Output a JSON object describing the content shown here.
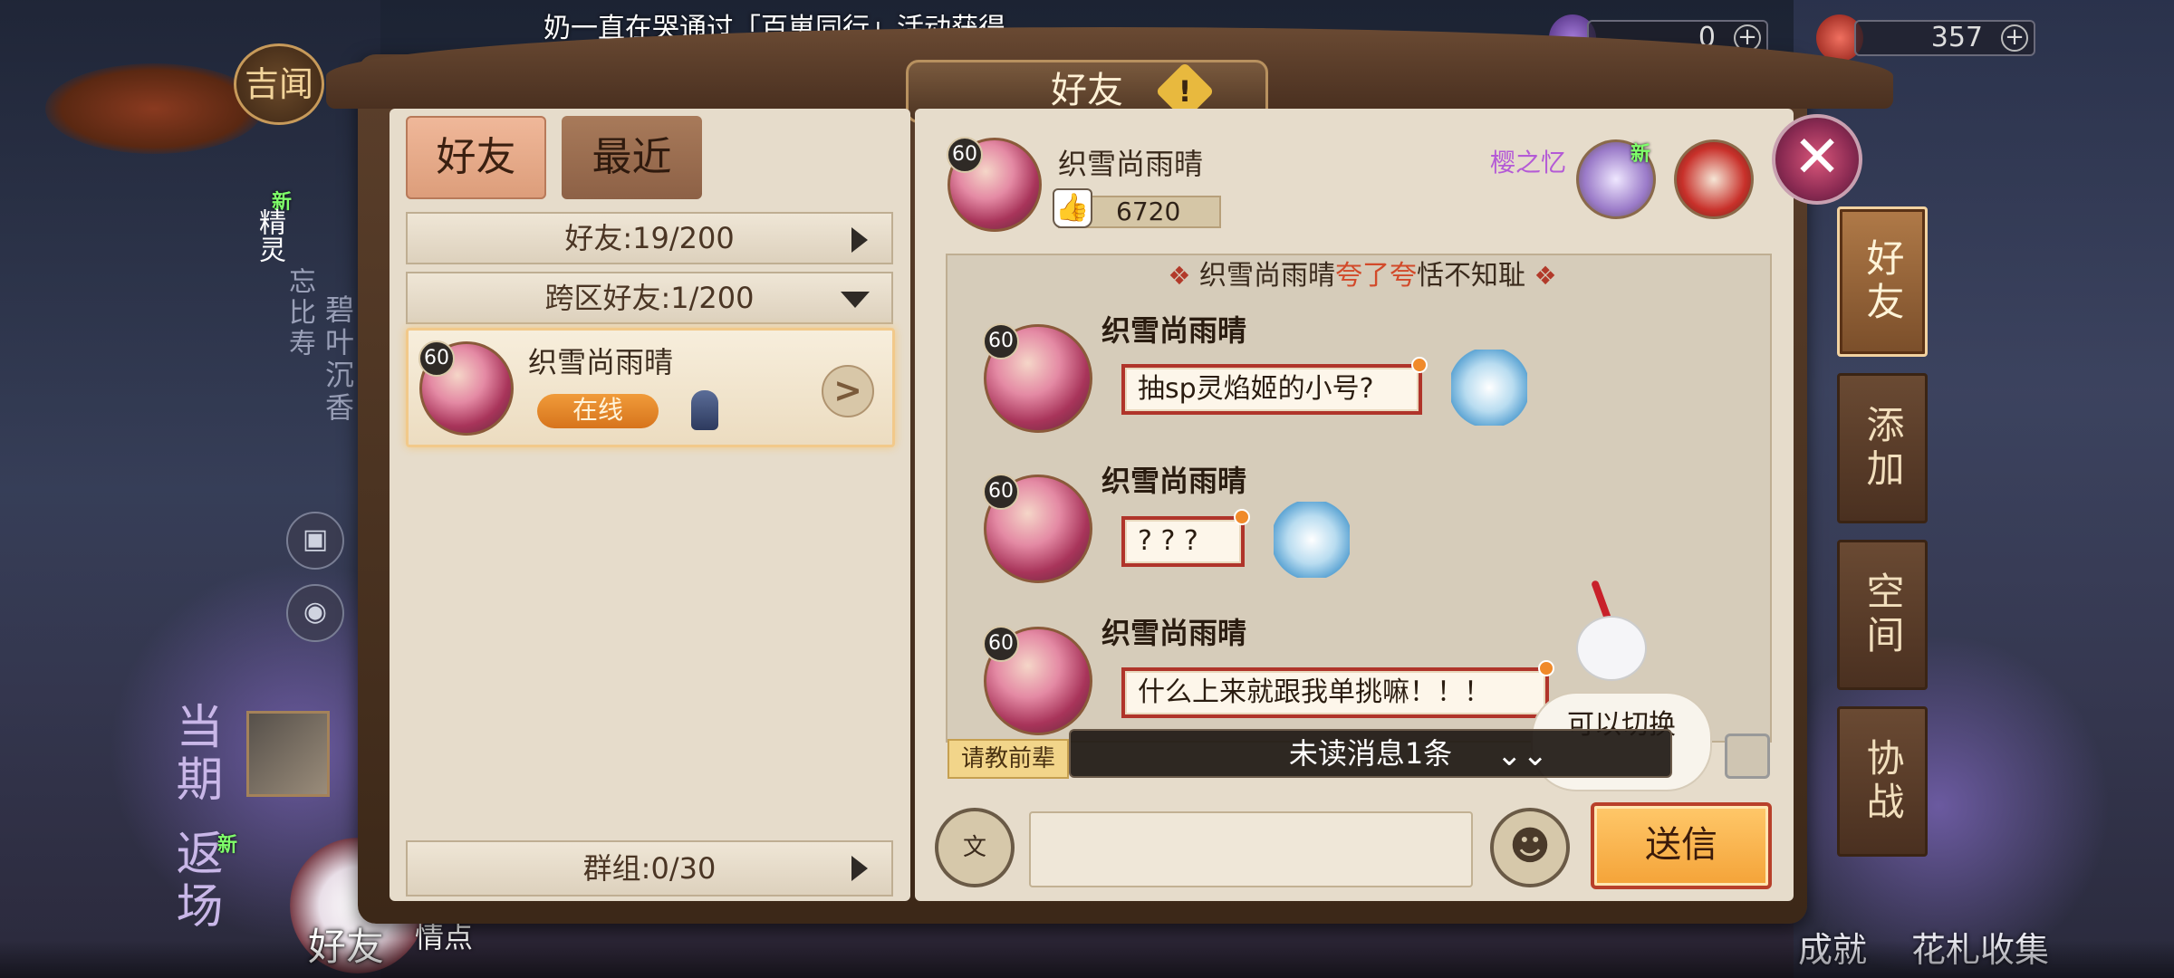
{
  "ticker": {
    "text": "奶一直在哭通过「百崽同行」活动获得"
  },
  "currencies": [
    {
      "value": "0",
      "plus": "+",
      "color": "#6a3aa0"
    },
    {
      "value": "357",
      "plus": "+",
      "color": "#c8302a"
    }
  ],
  "left_hud": {
    "jiwen_label": "吉闻",
    "sprite_label": "精灵",
    "sprite_new": "新",
    "side_text_1": "碧叶沉香",
    "side_text_2": "忘比寿",
    "current_label": "当期",
    "return_label": "返场",
    "return_new": "新",
    "friends_label": "好友",
    "qingdian_label": "情点"
  },
  "right_hud": {
    "achievement_label": "成就",
    "card_collect_label": "花札收集"
  },
  "panel": {
    "title": "好友",
    "warn_icon": "!",
    "close_icon": "✕"
  },
  "tabs": {
    "friends": "好友",
    "recent": "最近"
  },
  "friend_list": {
    "friends_count": "好友:19/200",
    "cross_server_count": "跨区好友:1/200",
    "group_count": "群组:0/30",
    "entries": [
      {
        "level": "60",
        "name": "织雪尚雨晴",
        "status": "在线"
      }
    ]
  },
  "chat": {
    "partner_level": "60",
    "partner_name": "织雪尚雨晴",
    "likes": "6720",
    "title_tag": "樱之忆",
    "title_new": "新",
    "praise": {
      "diamond": "❖",
      "name": "织雪尚雨晴",
      "action": "夸了夸",
      "trait": "恬不知耻"
    },
    "messages": [
      {
        "level": "60",
        "name": "织雪尚雨晴",
        "text": "抽sp灵焰姬的小号?"
      },
      {
        "level": "60",
        "name": "织雪尚雨晴",
        "text": "? ? ?"
      },
      {
        "level": "60",
        "name": "织雪尚雨晴",
        "text": "什么上来就跟我单挑嘛！！！"
      }
    ],
    "quick_tag": "请教前辈",
    "unread": "未读消息1条",
    "unread_icon": "⌄⌄",
    "mascot_tip": "可以切换",
    "input_value": "",
    "voice_label": "文",
    "emoji_icon": "☻",
    "send_label": "送信"
  },
  "side_tabs": [
    "好友",
    "添加",
    "空间",
    "协战"
  ]
}
